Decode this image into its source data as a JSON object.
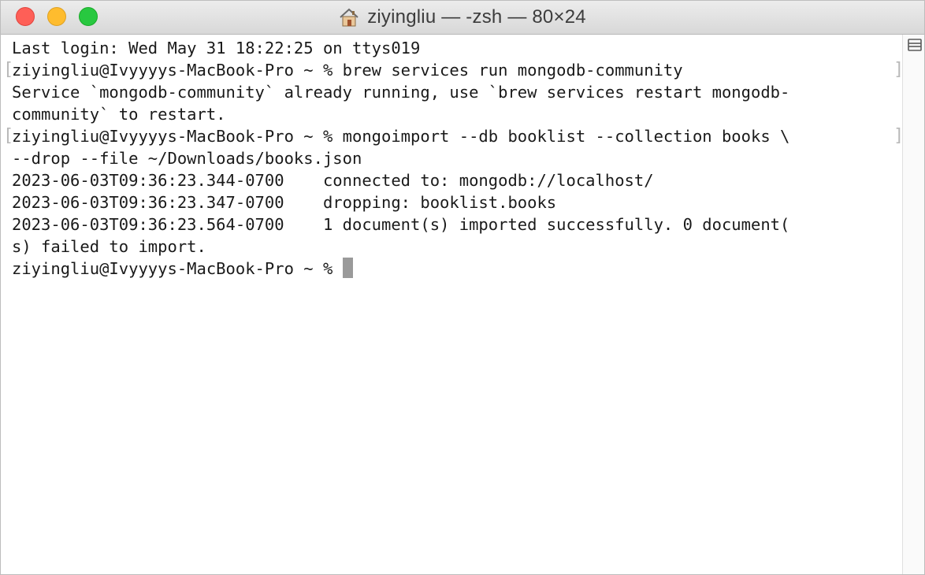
{
  "window": {
    "title": "ziyingliu — -zsh — 80×24",
    "icon": "home-icon"
  },
  "terminal": {
    "lines": [
      "Last login: Wed May 31 18:22:25 on ttys019",
      "ziyingliu@Ivyyyys-MacBook-Pro ~ % brew services run mongodb-community",
      "Service `mongodb-community` already running, use `brew services restart mongodb-",
      "community` to restart.",
      "ziyingliu@Ivyyyys-MacBook-Pro ~ % mongoimport --db booklist --collection books \\",
      "--drop --file ~/Downloads/books.json",
      "2023-06-03T09:36:23.344-0700    connected to: mongodb://localhost/",
      "2023-06-03T09:36:23.347-0700    dropping: booklist.books",
      "2023-06-03T09:36:23.564-0700    1 document(s) imported successfully. 0 document(",
      "s) failed to import.",
      "ziyingliu@Ivyyyys-MacBook-Pro ~ % "
    ]
  },
  "colors": {
    "close": "#fe5f57",
    "minimize": "#febc2e",
    "maximize": "#28c840",
    "cursor": "#9a9a9a"
  }
}
